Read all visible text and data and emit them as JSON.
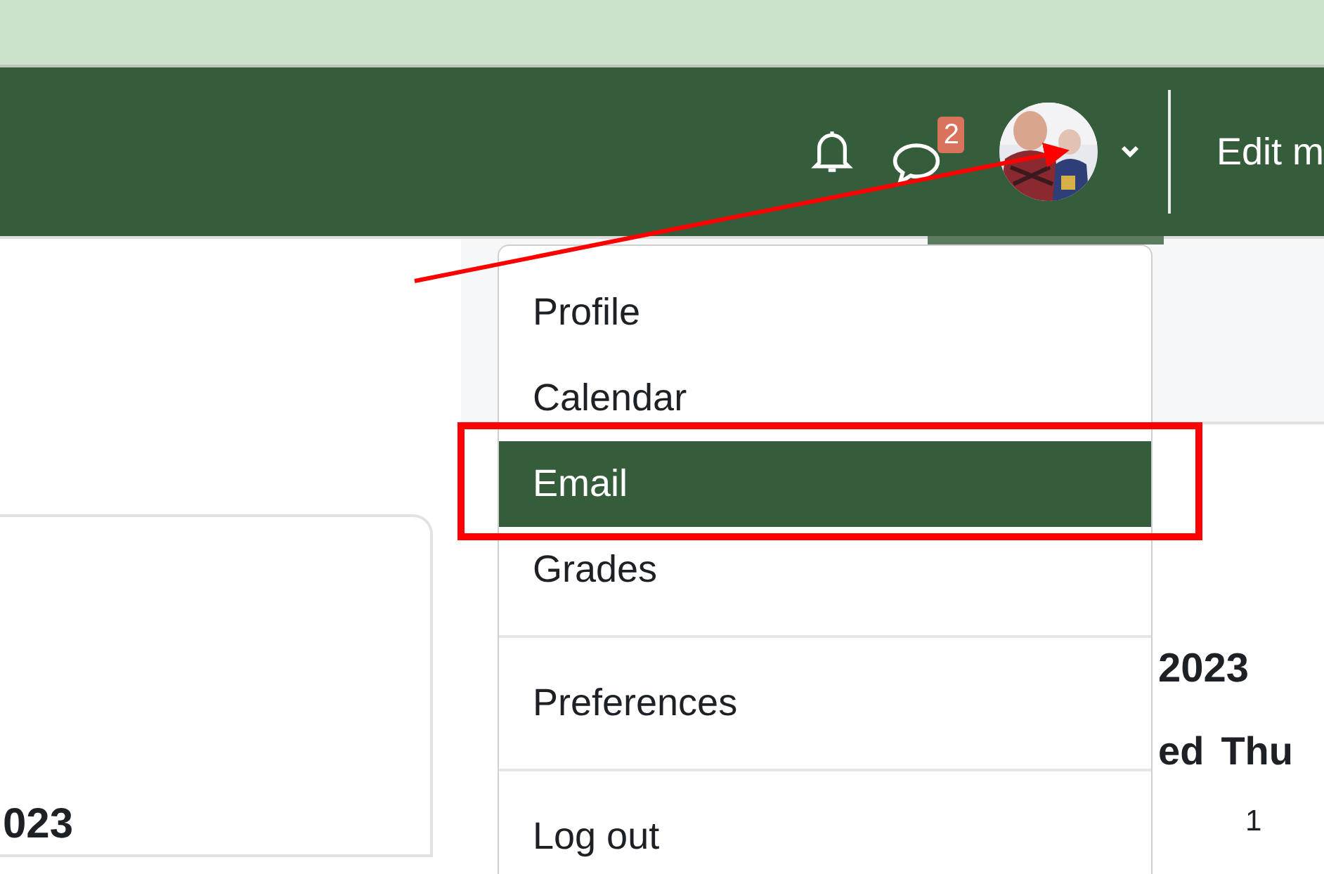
{
  "header": {
    "message_count": "2",
    "edit_mode_label": "Edit m"
  },
  "user_menu": {
    "expanded": true,
    "groups": [
      [
        {
          "label": "Profile",
          "selected": false
        },
        {
          "label": "Calendar",
          "selected": false
        },
        {
          "label": "Email",
          "selected": true
        },
        {
          "label": "Grades",
          "selected": false
        }
      ],
      [
        {
          "label": "Preferences",
          "selected": false
        }
      ],
      [
        {
          "label": "Log out",
          "selected": false
        }
      ]
    ]
  },
  "left_card": {
    "heading": "023"
  },
  "calendar": {
    "title": "2023",
    "day_headers": [
      "ed",
      "Thu"
    ],
    "dates": [
      "1"
    ]
  }
}
